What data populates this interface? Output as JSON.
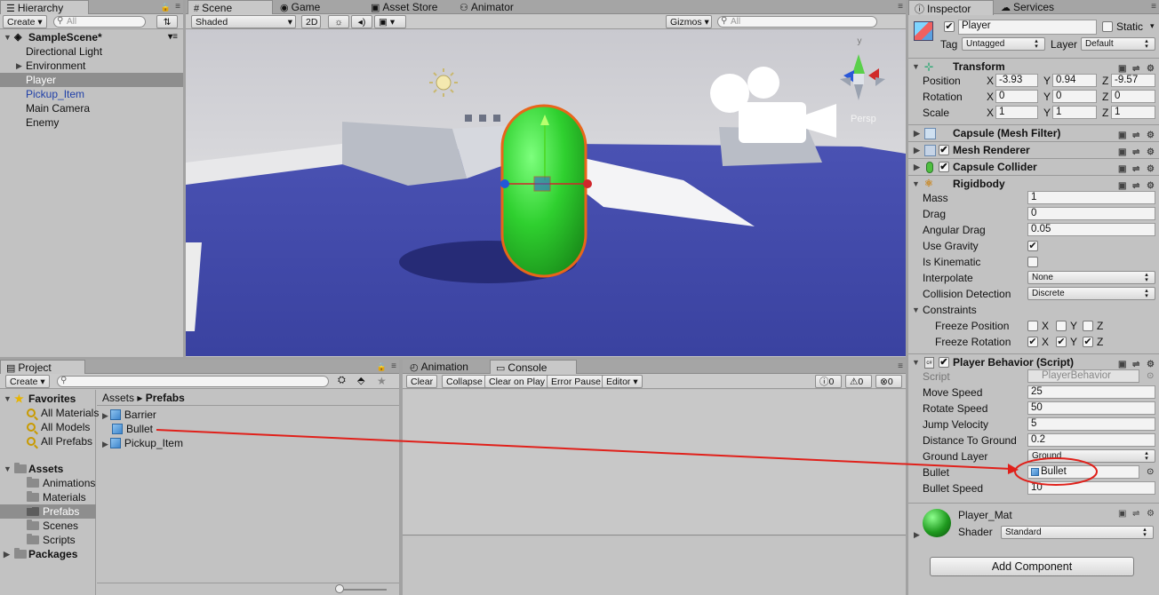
{
  "colors": {
    "selected_row": "#8e8e8e",
    "panel_bg": "#c2c2c2",
    "scene_floor": "#404aa8",
    "capsule": "#2fd02f",
    "capsule_outline": "#e8651a",
    "annotation": "#e0201a"
  },
  "hierarchy": {
    "tab": "Hierarchy",
    "create": "Create",
    "search_placeholder": "All",
    "scene": "SampleScene*",
    "items": [
      "Directional Light",
      "Environment",
      "Player",
      "Pickup_Item",
      "Main Camera",
      "Enemy"
    ],
    "selected": "Player"
  },
  "scene_view": {
    "tabs": [
      "Scene",
      "Game",
      "Asset Store",
      "Animator"
    ],
    "shading": "Shaded",
    "mode_2d": "2D",
    "gizmos": "Gizmos",
    "search_placeholder": "All",
    "persp": "Persp"
  },
  "inspector": {
    "tabs": [
      "Inspector",
      "Services"
    ],
    "object_name": "Player",
    "static_label": "Static",
    "tag_label": "Tag",
    "tag_value": "Untagged",
    "layer_label": "Layer",
    "layer_value": "Default",
    "transform": {
      "title": "Transform",
      "position_label": "Position",
      "position": [
        "-3.93",
        "0.94",
        "-9.57"
      ],
      "rotation_label": "Rotation",
      "rotation": [
        "0",
        "0",
        "0"
      ],
      "scale_label": "Scale",
      "scale": [
        "1",
        "1",
        "1"
      ],
      "axes": [
        "X",
        "Y",
        "Z"
      ]
    },
    "components": [
      "Capsule (Mesh Filter)",
      "Mesh Renderer",
      "Capsule Collider"
    ],
    "rigidbody": {
      "title": "Rigidbody",
      "mass_label": "Mass",
      "mass": "1",
      "drag_label": "Drag",
      "drag": "0",
      "angular_drag_label": "Angular Drag",
      "angular_drag": "0.05",
      "use_gravity_label": "Use Gravity",
      "use_gravity": true,
      "is_kinematic_label": "Is Kinematic",
      "is_kinematic": false,
      "interpolate_label": "Interpolate",
      "interpolate": "None",
      "collision_label": "Collision Detection",
      "collision": "Discrete",
      "constraints_label": "Constraints",
      "freeze_position_label": "Freeze Position",
      "freeze_rotation_label": "Freeze Rotation"
    },
    "script": {
      "title": "Player Behavior (Script)",
      "script_label": "Script",
      "script_value": "PlayerBehavior",
      "move_speed_label": "Move Speed",
      "move_speed": "25",
      "rotate_speed_label": "Rotate Speed",
      "rotate_speed": "50",
      "jump_velocity_label": "Jump Velocity",
      "jump_velocity": "5",
      "distance_label": "Distance To Ground",
      "distance": "0.2",
      "ground_layer_label": "Ground Layer",
      "ground_layer": "Ground",
      "bullet_label": "Bullet",
      "bullet": "Bullet",
      "bullet_speed_label": "Bullet Speed",
      "bullet_speed": "10"
    },
    "material": {
      "name": "Player_Mat",
      "shader_label": "Shader",
      "shader": "Standard"
    },
    "add_component": "Add Component"
  },
  "project": {
    "tab": "Project",
    "create": "Create",
    "favorites_label": "Favorites",
    "favorites": [
      "All Materials",
      "All Models",
      "All Prefabs"
    ],
    "assets_label": "Assets",
    "asset_folders": [
      "Animations",
      "Materials",
      "Prefabs",
      "Scenes",
      "Scripts"
    ],
    "packages_label": "Packages",
    "breadcrumb_root": "Assets",
    "breadcrumb_current": "Prefabs",
    "prefabs": [
      "Barrier",
      "Bullet",
      "Pickup_Item"
    ]
  },
  "console": {
    "tabs": [
      "Animation",
      "Console"
    ],
    "buttons": [
      "Clear",
      "Collapse",
      "Clear on Play",
      "Error Pause",
      "Editor"
    ],
    "counts": [
      "0",
      "0",
      "0"
    ]
  }
}
